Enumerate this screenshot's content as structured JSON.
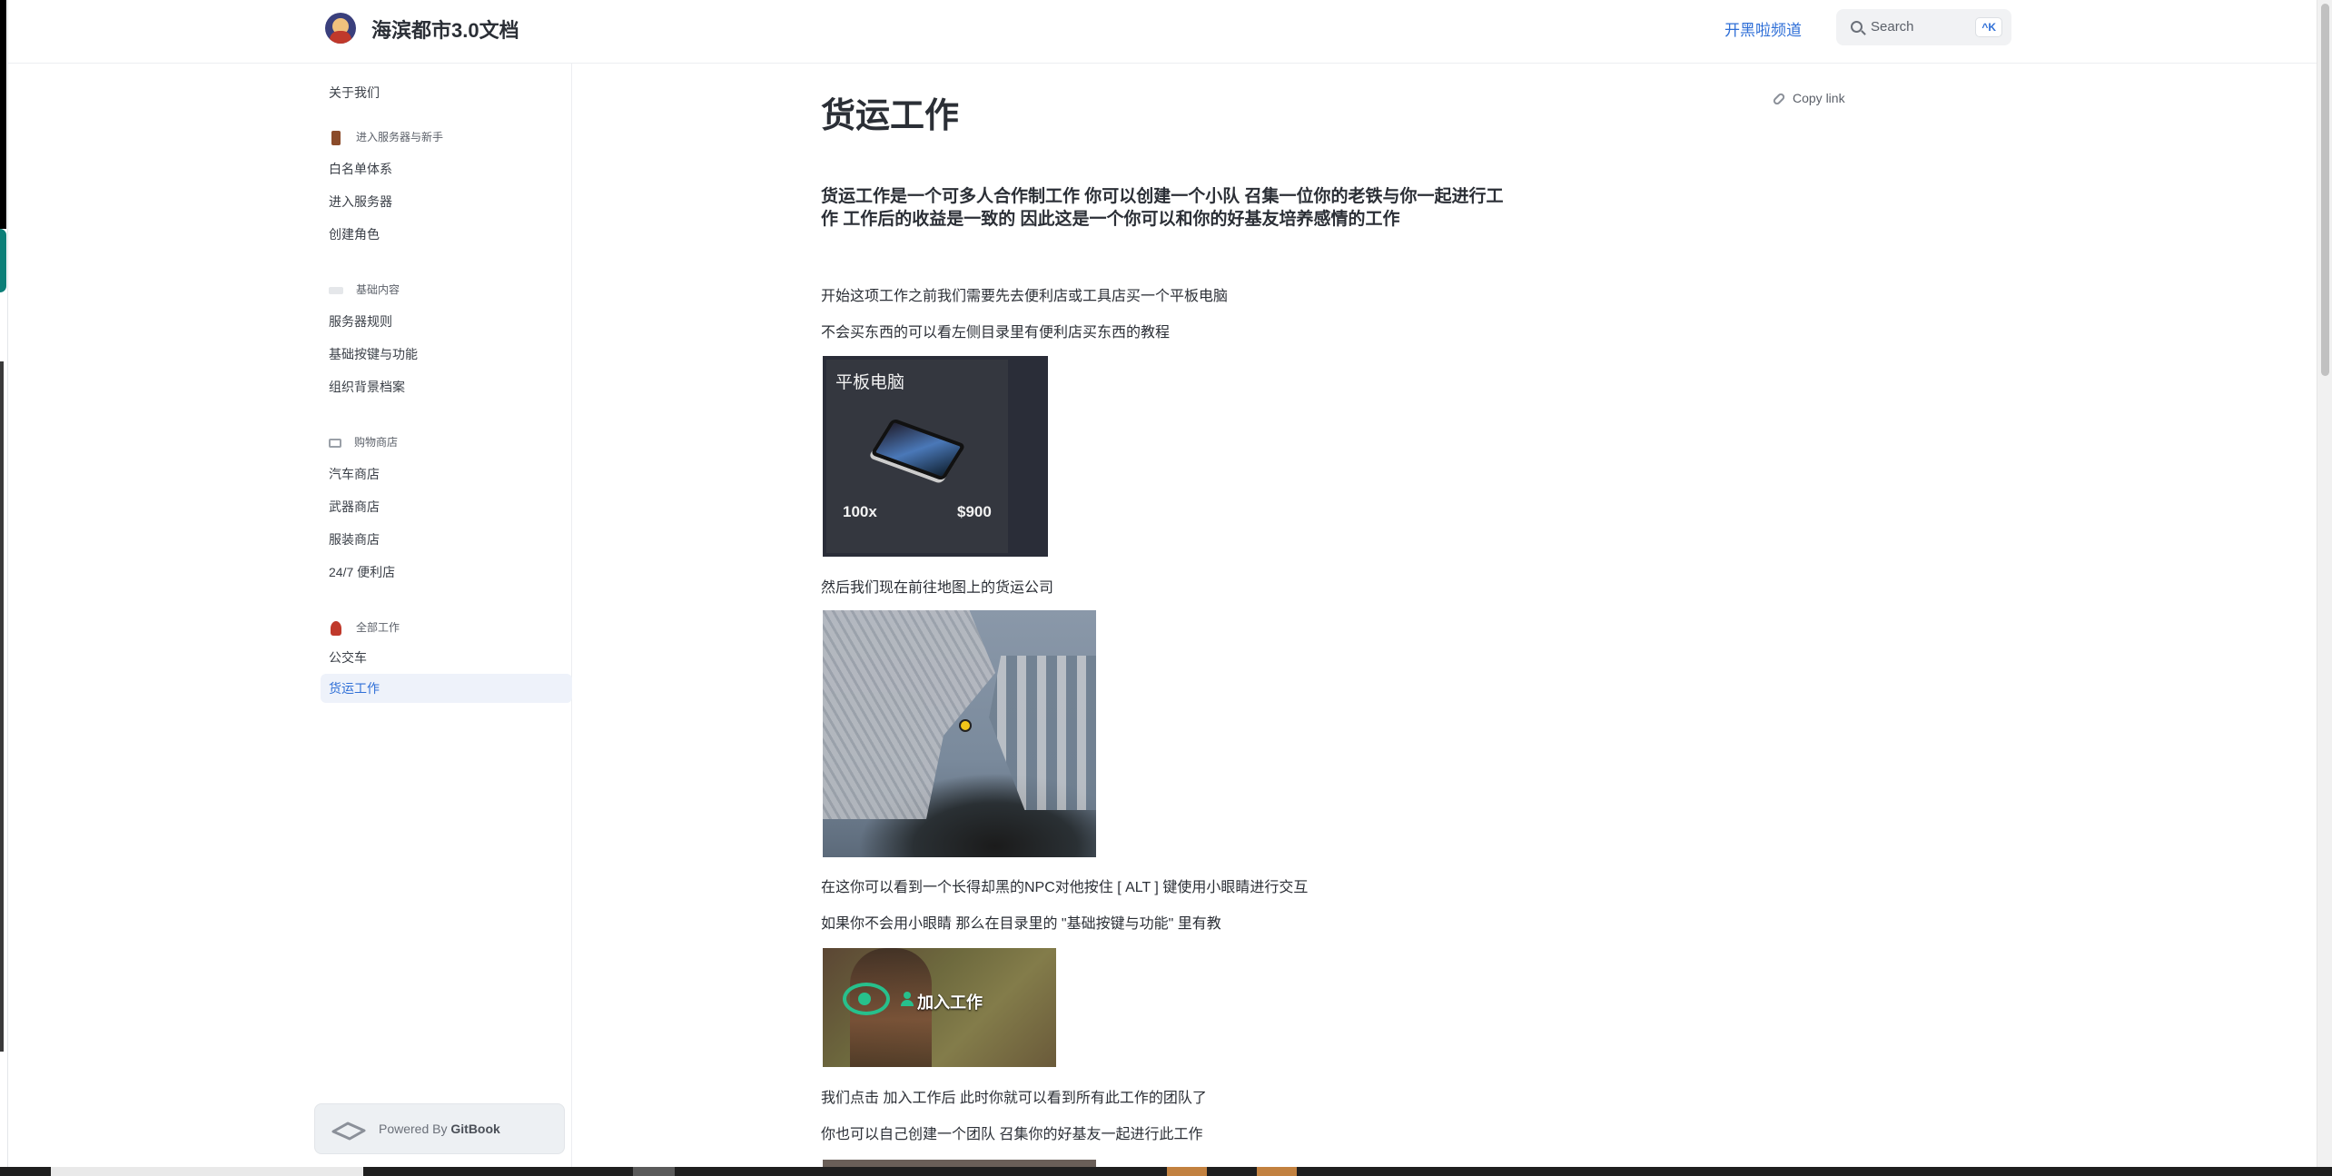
{
  "header": {
    "site_title": "海滨都市3.0文档",
    "channel_link": "开黑啦频道",
    "search_placeholder": "Search",
    "search_shortcut": "^K"
  },
  "sidebar": {
    "top_link": "关于我们",
    "groups": [
      {
        "title": "进入服务器与新手",
        "icon": "door-icon",
        "items": [
          "白名单体系",
          "进入服务器",
          "创建角色"
        ]
      },
      {
        "title": "基础内容",
        "icon": "keyboard-icon",
        "items": [
          "服务器规则",
          "基础按键与功能",
          "组织背景档案"
        ]
      },
      {
        "title": "购物商店",
        "icon": "cart-icon",
        "items": [
          "汽车商店",
          "武器商店",
          "服装商店",
          "24/7 便利店"
        ]
      },
      {
        "title": "全部工作",
        "icon": "person-icon",
        "items": [
          "公交车",
          "货运工作"
        ]
      }
    ],
    "active_item": "货运工作",
    "powered_by_prefix": "Powered By",
    "powered_by_brand": "GitBook"
  },
  "main": {
    "title": "货运工作",
    "copy_link": "Copy link",
    "lead": "货运工作是一个可多人合作制工作 你可以创建一个小队 召集一位你的老铁与你一起进行工作 工作后的收益是一致的 因此这是一个你可以和你的好基友培养感情的工作",
    "paragraphs": [
      "开始这项工作之前我们需要先去便利店或工具店买一个平板电脑",
      "不会买东西的可以看左侧目录里有便利店买东西的教程",
      "然后我们现在前往地图上的货运公司",
      "在这你可以看到一个长得却黑的NPC对他按住 [ ALT ] 键使用小眼睛进行交互",
      "如果你不会用小眼睛 那么在目录里的 \"基础按键与功能\" 里有教",
      "我们点击 加入工作后 此时你就可以看到所有此工作的团队了",
      "你也可以自己创建一个团队 召集你的好基友一起进行此工作"
    ],
    "tablet_item": {
      "name": "平板电脑",
      "quantity": "100x",
      "price": "$900"
    },
    "join_label": "加入工作"
  }
}
